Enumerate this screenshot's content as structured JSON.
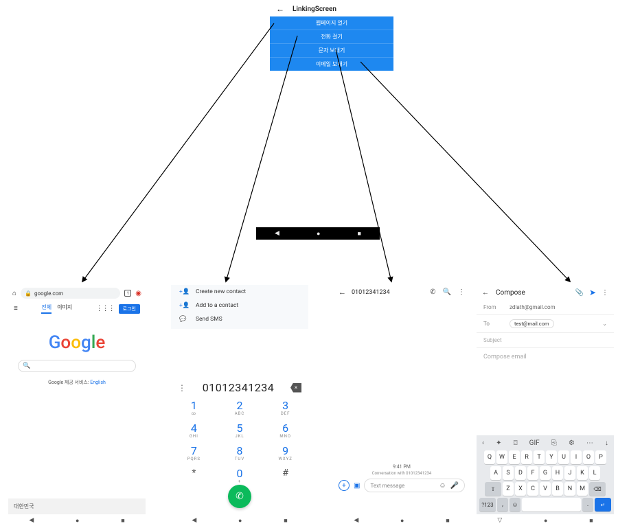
{
  "linking": {
    "title": "LinkingScreen",
    "items": [
      "웹페이지 열기",
      "전화 걸기",
      "문자 보내기",
      "이메일 보내기"
    ]
  },
  "browser": {
    "url": "google.com",
    "tabs": {
      "all": "전체",
      "images": "이미지"
    },
    "signin": "로그인",
    "logo": [
      "G",
      "o",
      "o",
      "g",
      "l",
      "e"
    ],
    "offered_prefix": "Google 제공 서비스: ",
    "offered_lang": "English",
    "footer": "대한민국"
  },
  "dialer": {
    "actions": {
      "new_contact": "Create new contact",
      "add_contact": "Add to a contact",
      "send_sms": "Send SMS"
    },
    "number": "01012341234",
    "keys": [
      {
        "d": "1",
        "l": "∞"
      },
      {
        "d": "2",
        "l": "ABC"
      },
      {
        "d": "3",
        "l": "DEF"
      },
      {
        "d": "4",
        "l": "GHI"
      },
      {
        "d": "5",
        "l": "JKL"
      },
      {
        "d": "6",
        "l": "MNO"
      },
      {
        "d": "7",
        "l": "PQRS"
      },
      {
        "d": "8",
        "l": "TUV"
      },
      {
        "d": "9",
        "l": "WXYZ"
      },
      {
        "d": "*",
        "l": ""
      },
      {
        "d": "0",
        "l": "+"
      },
      {
        "d": "#",
        "l": ""
      }
    ]
  },
  "sms": {
    "title": "01012341234",
    "time": "9:41 PM",
    "conv_line": "Conversation with 01012341234",
    "placeholder": "Text message"
  },
  "email": {
    "title": "Compose",
    "from_label": "From",
    "from_value": "zdlath@gmail.com",
    "to_label": "To",
    "to_value": "test@mail.com",
    "subject_placeholder": "Subject",
    "body_placeholder": "Compose email"
  },
  "keyboard": {
    "toolbar_icons": [
      "‹",
      "✦",
      "⌼",
      "GIF",
      "⎘",
      "⚙",
      "⋯",
      "↓"
    ],
    "row1": [
      "Q",
      "W",
      "E",
      "R",
      "T",
      "Y",
      "U",
      "I",
      "O",
      "P"
    ],
    "row2": [
      "A",
      "S",
      "D",
      "F",
      "G",
      "H",
      "J",
      "K",
      "L"
    ],
    "row3_shift": "⇧",
    "row3": [
      "Z",
      "X",
      "C",
      "V",
      "B",
      "N",
      "M"
    ],
    "row3_bksp": "⌫",
    "row4_sym": "?123",
    "row4_comma": ",",
    "row4_emoji": "☺",
    "row4_period": ".",
    "row4_enter": "↵"
  }
}
